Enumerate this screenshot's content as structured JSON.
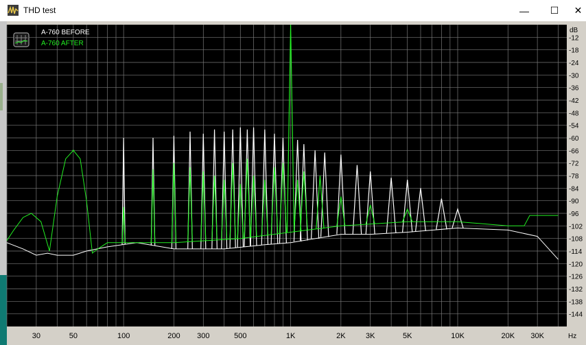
{
  "window": {
    "title": "THD test",
    "minimize_glyph": "—",
    "maximize_glyph": "☐",
    "close_glyph": "✕"
  },
  "colors": {
    "plot_bg": "#000000",
    "grid": "#7a7a7a",
    "before_series": "#ffffff",
    "after_series": "#22ee22",
    "axis_text": "#000000"
  },
  "chart_data": {
    "type": "line",
    "title": "",
    "xlabel": "Hz",
    "ylabel": "dB",
    "xscale": "log",
    "xlim": [
      20,
      45000
    ],
    "ylim": [
      -150,
      -6
    ],
    "grid": true,
    "legend_position": "top-left",
    "x_tick_labels": [
      "30",
      "50",
      "100",
      "200",
      "300",
      "500",
      "1K",
      "2K",
      "3K",
      "5K",
      "10K",
      "20K",
      "30K"
    ],
    "x_tick_values": [
      30,
      50,
      100,
      200,
      300,
      500,
      1000,
      2000,
      3000,
      5000,
      10000,
      20000,
      30000
    ],
    "y_tick_labels": [
      "-12",
      "-18",
      "-24",
      "-30",
      "-36",
      "-42",
      "-48",
      "-54",
      "-60",
      "-66",
      "-72",
      "-78",
      "-84",
      "-90",
      "-96",
      "-102",
      "-108",
      "-114",
      "-120",
      "-126",
      "-132",
      "-138",
      "-144"
    ],
    "y_tick_values": [
      -12,
      -18,
      -24,
      -30,
      -36,
      -42,
      -48,
      -54,
      -60,
      -66,
      -72,
      -78,
      -84,
      -90,
      -96,
      -102,
      -108,
      -114,
      -120,
      -126,
      -132,
      -138,
      -144
    ],
    "fundamental_hz": 1000,
    "fundamental_db": -6,
    "series": [
      {
        "name": "A-760 BEFORE",
        "color": "#ffffff",
        "peaks": [
          {
            "x": 100,
            "y": -60
          },
          {
            "x": 150,
            "y": -60
          },
          {
            "x": 200,
            "y": -59
          },
          {
            "x": 250,
            "y": -57
          },
          {
            "x": 300,
            "y": -58
          },
          {
            "x": 350,
            "y": -56
          },
          {
            "x": 400,
            "y": -57
          },
          {
            "x": 450,
            "y": -56
          },
          {
            "x": 500,
            "y": -55
          },
          {
            "x": 550,
            "y": -56
          },
          {
            "x": 600,
            "y": -55
          },
          {
            "x": 700,
            "y": -56
          },
          {
            "x": 800,
            "y": -58
          },
          {
            "x": 900,
            "y": -60
          },
          {
            "x": 1100,
            "y": -61
          },
          {
            "x": 1200,
            "y": -63
          },
          {
            "x": 1400,
            "y": -66
          },
          {
            "x": 1600,
            "y": -67
          },
          {
            "x": 2000,
            "y": -68
          },
          {
            "x": 2500,
            "y": -73
          },
          {
            "x": 3000,
            "y": -76
          },
          {
            "x": 4000,
            "y": -79
          },
          {
            "x": 5000,
            "y": -80
          },
          {
            "x": 6000,
            "y": -84
          },
          {
            "x": 8000,
            "y": -89
          },
          {
            "x": 10000,
            "y": -94
          }
        ],
        "floor": [
          {
            "x": 20,
            "y": -110
          },
          {
            "x": 25,
            "y": -113
          },
          {
            "x": 30,
            "y": -116
          },
          {
            "x": 35,
            "y": -115
          },
          {
            "x": 40,
            "y": -116
          },
          {
            "x": 50,
            "y": -116
          },
          {
            "x": 60,
            "y": -114
          },
          {
            "x": 80,
            "y": -112
          },
          {
            "x": 120,
            "y": -110
          },
          {
            "x": 200,
            "y": -113
          },
          {
            "x": 400,
            "y": -113
          },
          {
            "x": 700,
            "y": -111
          },
          {
            "x": 1000,
            "y": -110
          },
          {
            "x": 2000,
            "y": -106
          },
          {
            "x": 3000,
            "y": -106
          },
          {
            "x": 5000,
            "y": -105
          },
          {
            "x": 10000,
            "y": -103
          },
          {
            "x": 20000,
            "y": -104
          },
          {
            "x": 30000,
            "y": -107
          },
          {
            "x": 40000,
            "y": -118
          }
        ]
      },
      {
        "name": "A-760 AFTER",
        "color": "#22ee22",
        "peaks": [
          {
            "x": 50,
            "y": -66
          },
          {
            "x": 100,
            "y": -93
          },
          {
            "x": 150,
            "y": -75
          },
          {
            "x": 200,
            "y": -72
          },
          {
            "x": 250,
            "y": -74
          },
          {
            "x": 300,
            "y": -76
          },
          {
            "x": 350,
            "y": -78
          },
          {
            "x": 400,
            "y": -80
          },
          {
            "x": 450,
            "y": -72
          },
          {
            "x": 500,
            "y": -82
          },
          {
            "x": 550,
            "y": -70
          },
          {
            "x": 600,
            "y": -78
          },
          {
            "x": 700,
            "y": -80
          },
          {
            "x": 800,
            "y": -74
          },
          {
            "x": 900,
            "y": -72
          },
          {
            "x": 1000,
            "y": -6
          },
          {
            "x": 1100,
            "y": -80
          },
          {
            "x": 1200,
            "y": -76
          },
          {
            "x": 1500,
            "y": -78
          },
          {
            "x": 2000,
            "y": -88
          },
          {
            "x": 3000,
            "y": -92
          },
          {
            "x": 5000,
            "y": -94
          }
        ],
        "floor": [
          {
            "x": 20,
            "y": -109
          },
          {
            "x": 22,
            "y": -104
          },
          {
            "x": 25,
            "y": -98
          },
          {
            "x": 28,
            "y": -96
          },
          {
            "x": 32,
            "y": -100
          },
          {
            "x": 36,
            "y": -114
          },
          {
            "x": 40,
            "y": -88
          },
          {
            "x": 45,
            "y": -70
          },
          {
            "x": 50,
            "y": -66
          },
          {
            "x": 55,
            "y": -70
          },
          {
            "x": 60,
            "y": -90
          },
          {
            "x": 65,
            "y": -115
          },
          {
            "x": 70,
            "y": -113
          },
          {
            "x": 80,
            "y": -110
          },
          {
            "x": 100,
            "y": -110
          },
          {
            "x": 200,
            "y": -110
          },
          {
            "x": 500,
            "y": -108
          },
          {
            "x": 1000,
            "y": -105
          },
          {
            "x": 2000,
            "y": -102
          },
          {
            "x": 5000,
            "y": -100
          },
          {
            "x": 10000,
            "y": -100
          },
          {
            "x": 20000,
            "y": -102
          },
          {
            "x": 25000,
            "y": -102
          },
          {
            "x": 27000,
            "y": -97
          },
          {
            "x": 40000,
            "y": -97
          }
        ]
      }
    ]
  }
}
